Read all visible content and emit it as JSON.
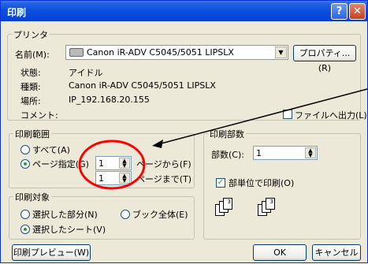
{
  "titlebar": {
    "title": "印刷",
    "help_label": "?",
    "close_label": "✕"
  },
  "printer": {
    "group_label": "プリンタ",
    "name_label": "名前(M):",
    "name_value": "Canon iR-ADV C5045/5051 LIPSLX",
    "properties_label": "プロパティ...(R)",
    "status_label": "状態:",
    "status_value": "アイドル",
    "type_label": "種類:",
    "type_value": "Canon iR-ADV C5045/5051 LIPSLX",
    "location_label": "場所:",
    "location_value": "IP_192.168.20.155",
    "comment_label": "コメント:",
    "print_to_file_label": "ファイルへ出力(L)"
  },
  "print_range": {
    "group_label": "印刷範囲",
    "all_label": "すべて(A)",
    "pages_label": "ページ指定(G)",
    "from_value": "1",
    "from_label": "ページから(F)",
    "to_value": "1",
    "to_label": "ページまで(T)"
  },
  "copies": {
    "group_label": "印刷部数",
    "count_label": "部数(C):",
    "count_value": "1",
    "collate_label": "部単位で印刷(O)"
  },
  "print_what": {
    "group_label": "印刷対象",
    "selection_label": "選択した部分(N)",
    "workbook_label": "ブック全体(E)",
    "sheets_label": "選択したシート(V)"
  },
  "footer": {
    "preview_label": "印刷プレビュー(W)",
    "ok_label": "OK",
    "cancel_label": "キャンセル"
  },
  "annotation": {
    "color": "#ff0000"
  }
}
